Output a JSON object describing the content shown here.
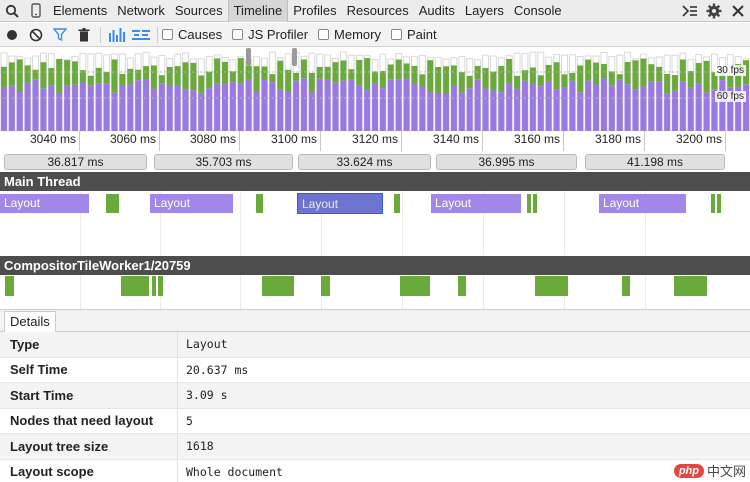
{
  "tabs": [
    "Elements",
    "Network",
    "Sources",
    "Timeline",
    "Profiles",
    "Resources",
    "Audits",
    "Layers",
    "Console"
  ],
  "selected_tab": "Timeline",
  "toolbar": {
    "checkboxes": [
      "Causes",
      "JS Profiler",
      "Memory",
      "Paint"
    ]
  },
  "overview": {
    "fps_30": "30 fps",
    "fps_60": "60 fps",
    "colors": {
      "scripting": "#6aaa3a",
      "rendering": "#9a79e4",
      "idle": "#ffffff"
    }
  },
  "ruler": [
    "3040 ms",
    "3060 ms",
    "3080 ms",
    "3100 ms",
    "3120 ms",
    "3140 ms",
    "3160 ms",
    "3180 ms",
    "3200 ms"
  ],
  "frames": [
    "36.817 ms",
    "35.703 ms",
    "33.624 ms",
    "36.995 ms",
    "41.198 ms"
  ],
  "main_thread": {
    "title": "Main Thread",
    "layout_label": "Layout"
  },
  "compositor": {
    "title": "CompositorTileWorker1/20759"
  },
  "details": {
    "tab": "Details",
    "rows": [
      {
        "key": "Type",
        "value": "Layout"
      },
      {
        "key": "Self Time",
        "value": "20.637 ms"
      },
      {
        "key": "Start Time",
        "value": "3.09 s"
      },
      {
        "key": "Nodes that need layout",
        "value": "5"
      },
      {
        "key": "Layout tree size",
        "value": "1618"
      },
      {
        "key": "Layout scope",
        "value": "Whole document"
      }
    ]
  },
  "watermark": {
    "logo": "php",
    "text": "中文网"
  }
}
